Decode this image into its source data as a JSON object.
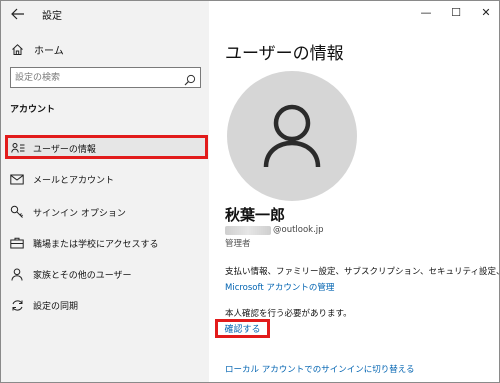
{
  "titlebar": {
    "back_icon": "back-arrow-icon",
    "title": "設定"
  },
  "window_controls": {
    "minimize": "—",
    "maximize": "☐",
    "close": "✕"
  },
  "sidebar": {
    "home_label": "ホーム",
    "search_placeholder": "設定の検索",
    "section_label": "アカウント",
    "items": [
      {
        "label": "ユーザーの情報",
        "icon": "user-info-icon",
        "active": true
      },
      {
        "label": "メールとアカウント",
        "icon": "mail-icon",
        "active": false
      },
      {
        "label": "サインイン オプション",
        "icon": "key-icon",
        "active": false
      },
      {
        "label": "職場または学校にアクセスする",
        "icon": "briefcase-icon",
        "active": false
      },
      {
        "label": "家族とその他のユーザー",
        "icon": "person-icon",
        "active": false
      },
      {
        "label": "設定の同期",
        "icon": "sync-icon",
        "active": false
      }
    ]
  },
  "main": {
    "page_title": "ユーザーの情報",
    "user_name": "秋葉一郎",
    "email_domain": "@outlook.jp",
    "role": "管理者",
    "billing_text": "支払い情報、ファミリー設定、サブスクリプション、セキュリティ設定、その他",
    "ms_account_link": "Microsoft アカウントの管理",
    "verify_text": "本人確認を行う必要があります。",
    "verify_link": "確認する",
    "local_account_link": "ローカル アカウントでのサインインに切り替える"
  },
  "colors": {
    "accent_link": "#0063b1",
    "highlight": "#e21b1b",
    "sidebar_bg": "#f2f2f2"
  }
}
